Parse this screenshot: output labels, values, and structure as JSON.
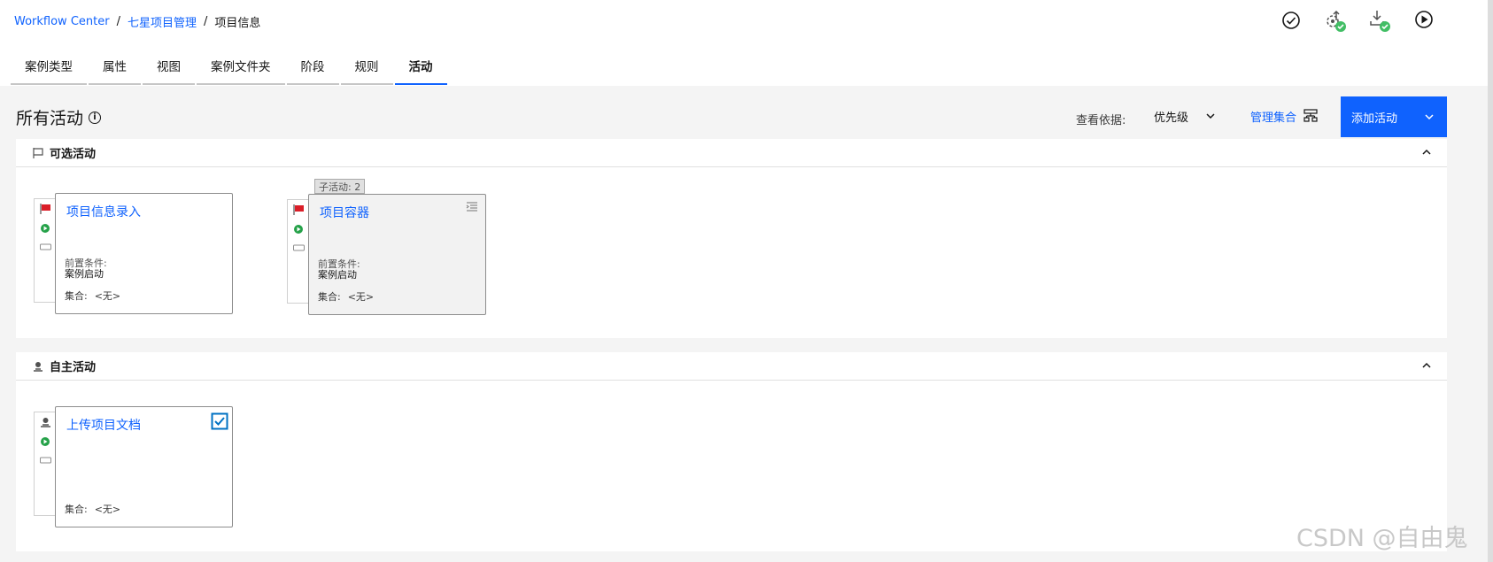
{
  "breadcrumb": {
    "items": [
      {
        "label": "Workflow Center"
      },
      {
        "label": "七星项目管理"
      }
    ],
    "separator": "/",
    "current": "项目信息"
  },
  "toolbar_icons": [
    "validate-icon",
    "publish-icon",
    "deploy-icon",
    "run-icon"
  ],
  "tabs": [
    {
      "label": "案例类型"
    },
    {
      "label": "属性"
    },
    {
      "label": "视图"
    },
    {
      "label": "案例文件夹"
    },
    {
      "label": "阶段"
    },
    {
      "label": "规则"
    },
    {
      "label": "活动",
      "active": true
    }
  ],
  "page": {
    "title": "所有活动",
    "view_by_label": "查看依据:",
    "view_by_value": "优先级",
    "manage_sets": "管理集合",
    "add_activity": "添加活动"
  },
  "sections": [
    {
      "title": "可选活动",
      "cards": [
        {
          "title": "项目信息录入",
          "precondition_label": "前置条件:",
          "precondition": "案例启动",
          "set_label": "集合:",
          "set_value": "<无>"
        },
        {
          "title": "项目容器",
          "badge": "子活动: 2",
          "precondition_label": "前置条件:",
          "precondition": "案例启动",
          "set_label": "集合:",
          "set_value": "<无>"
        }
      ]
    },
    {
      "title": "自主活动",
      "cards": [
        {
          "title": "上传项目文档",
          "set_label": "集合:",
          "set_value": "<无>"
        }
      ]
    }
  ],
  "watermark": "CSDN @自由鬼",
  "colors": {
    "accent": "#0f62fe",
    "background": "#f4f4f4"
  }
}
